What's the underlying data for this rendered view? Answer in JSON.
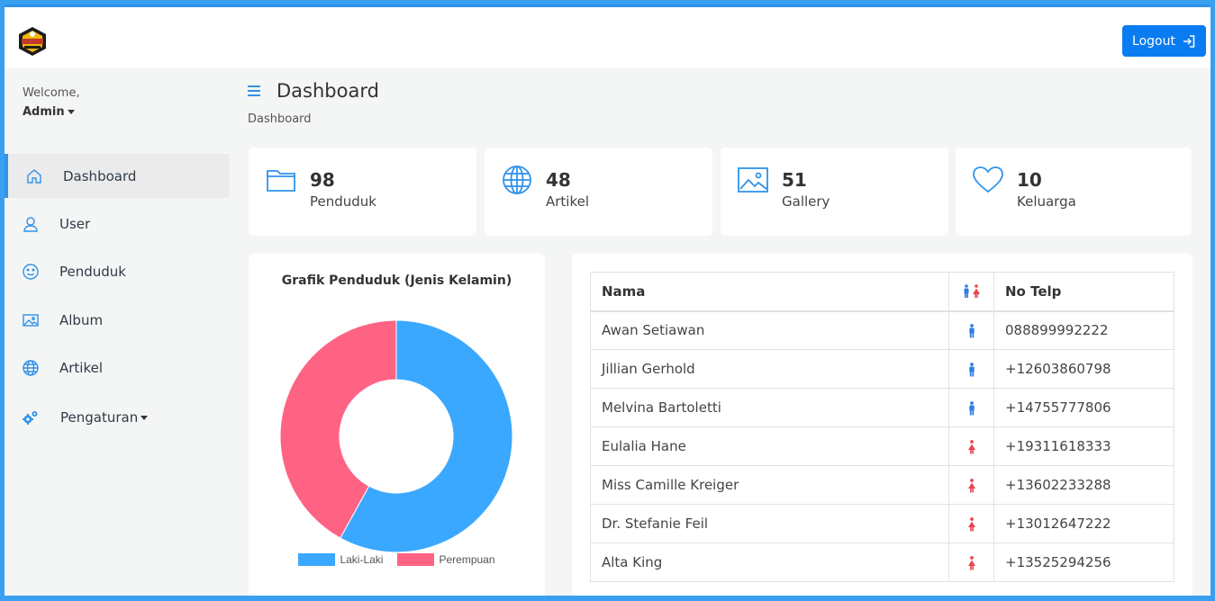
{
  "header": {
    "logout_label": "Logout"
  },
  "sidebar": {
    "welcome": "Welcome,",
    "user": "Admin",
    "items": [
      {
        "label": "Dashboard",
        "icon": "home-icon",
        "active": true
      },
      {
        "label": "User",
        "icon": "user-icon"
      },
      {
        "label": "Penduduk",
        "icon": "smile-icon"
      },
      {
        "label": "Album",
        "icon": "image-icon"
      },
      {
        "label": "Artikel",
        "icon": "globe-icon"
      },
      {
        "label": "Pengaturan",
        "icon": "gears-icon",
        "has_dropdown": true
      }
    ]
  },
  "page": {
    "title": "Dashboard",
    "breadcrumb": "Dashboard"
  },
  "stats": [
    {
      "value": "98",
      "label": "Penduduk",
      "icon": "folder-icon"
    },
    {
      "value": "48",
      "label": "Artikel",
      "icon": "globe-icon"
    },
    {
      "value": "51",
      "label": "Gallery",
      "icon": "image-icon"
    },
    {
      "value": "10",
      "label": "Keluarga",
      "icon": "heart-icon"
    }
  ],
  "chart_data": {
    "type": "pie",
    "title": "Grafik Penduduk (Jenis Kelamin)",
    "categories": [
      "Laki-Laki",
      "Perempuan"
    ],
    "values": [
      58,
      42
    ],
    "colors": [
      "#3ba8ff",
      "#ff6384"
    ],
    "legend_position": "bottom"
  },
  "table": {
    "headers": {
      "nama": "Nama",
      "no_telp": "No Telp"
    },
    "rows": [
      {
        "nama": "Awan Setiawan",
        "gender": "male",
        "telp": "088899992222"
      },
      {
        "nama": "Jillian Gerhold",
        "gender": "male",
        "telp": "+12603860798"
      },
      {
        "nama": "Melvina Bartoletti",
        "gender": "male",
        "telp": "+14755777806"
      },
      {
        "nama": "Eulalia Hane",
        "gender": "female",
        "telp": "+19311618333"
      },
      {
        "nama": "Miss Camille Kreiger",
        "gender": "female",
        "telp": "+13602233288"
      },
      {
        "nama": "Dr. Stefanie Feil",
        "gender": "female",
        "telp": "+13012647222"
      },
      {
        "nama": "Alta King",
        "gender": "female",
        "telp": "+13525294256"
      }
    ]
  },
  "colors": {
    "accent": "#2f93ea",
    "button": "#0a7cf2",
    "male": "#2f7de1",
    "female": "#e8454f"
  }
}
